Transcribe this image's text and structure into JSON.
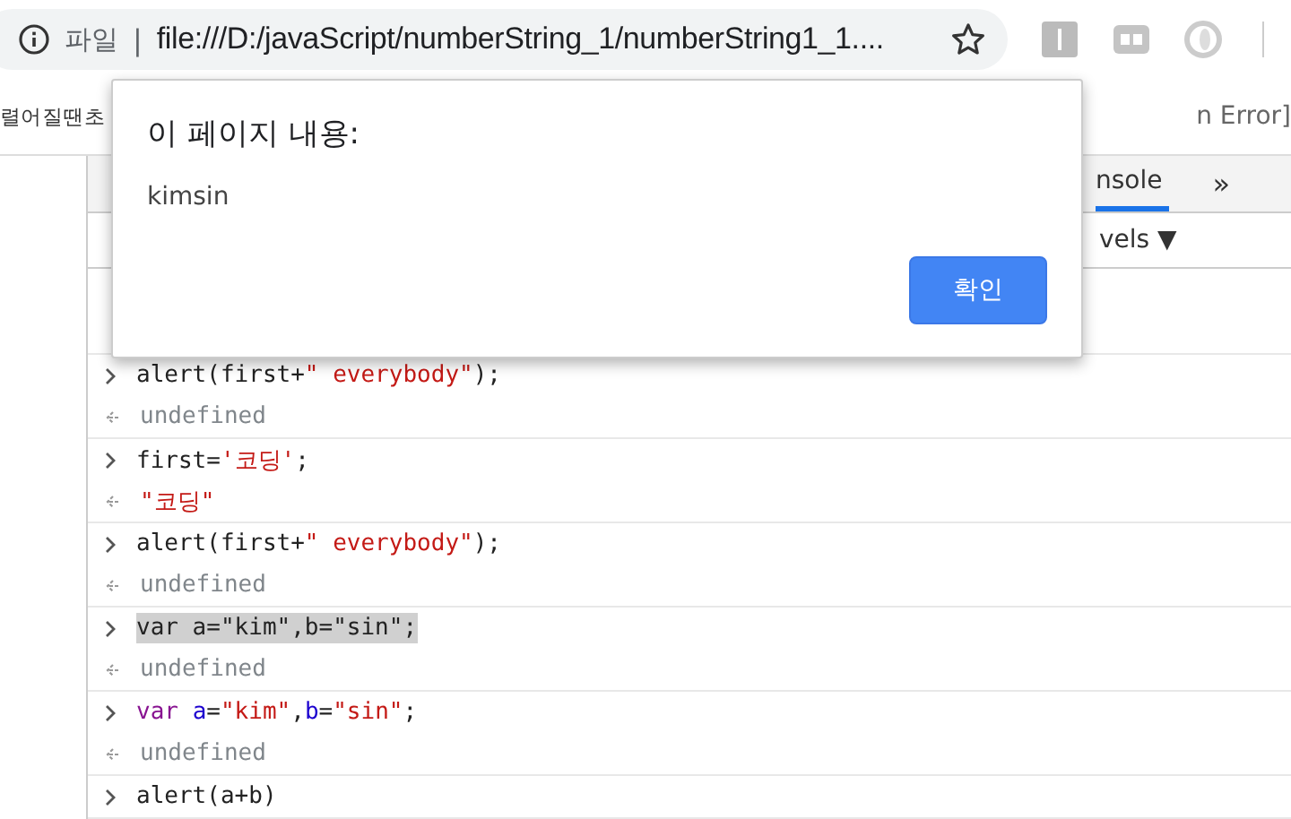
{
  "address_bar": {
    "scheme_label": "파일",
    "separator": "|",
    "url": "file:///D:/javaScript/numberString_1/numberString1_1...."
  },
  "bookmarks": {
    "left_text": "렬어질땐초",
    "right_text": "n Error]"
  },
  "devtools": {
    "tabs": [
      {
        "label": "nsole",
        "selected": true
      }
    ],
    "more_tabs": "»",
    "levels": "vels ▼",
    "console_rows": [
      {
        "input": [
          {
            "kind": "plain",
            "text": "alert(first+"
          },
          {
            "kind": "string",
            "text": "\" everybody\""
          },
          {
            "kind": "plain",
            "text": ");"
          }
        ],
        "selected": false,
        "output": {
          "kind": "undefined",
          "text": "undefined"
        }
      },
      {
        "input": [
          {
            "kind": "plain",
            "text": "first="
          },
          {
            "kind": "string",
            "text": "'코딩'"
          },
          {
            "kind": "plain",
            "text": ";"
          }
        ],
        "selected": false,
        "output": {
          "kind": "string",
          "text": "\"코딩\""
        }
      },
      {
        "input": [
          {
            "kind": "plain",
            "text": "alert(first+"
          },
          {
            "kind": "string",
            "text": "\" everybody\""
          },
          {
            "kind": "plain",
            "text": ");"
          }
        ],
        "selected": false,
        "output": {
          "kind": "undefined",
          "text": "undefined"
        }
      },
      {
        "input": [
          {
            "kind": "plain",
            "text": "var a=\"kim\",b=\"sin\";"
          }
        ],
        "selected": true,
        "output": {
          "kind": "undefined",
          "text": "undefined"
        }
      },
      {
        "input": [
          {
            "kind": "keyword",
            "text": "var "
          },
          {
            "kind": "name",
            "text": "a"
          },
          {
            "kind": "plain",
            "text": "="
          },
          {
            "kind": "string",
            "text": "\"kim\""
          },
          {
            "kind": "plain",
            "text": ","
          },
          {
            "kind": "name",
            "text": "b"
          },
          {
            "kind": "plain",
            "text": "="
          },
          {
            "kind": "string",
            "text": "\"sin\""
          },
          {
            "kind": "plain",
            "text": ";"
          }
        ],
        "selected": false,
        "output": {
          "kind": "undefined",
          "text": "undefined"
        }
      },
      {
        "input": [
          {
            "kind": "plain",
            "text": "alert(a+b)"
          }
        ],
        "selected": false
      }
    ]
  },
  "dialog": {
    "title": "이 페이지 내용:",
    "message": "kimsin",
    "button": "확인"
  }
}
